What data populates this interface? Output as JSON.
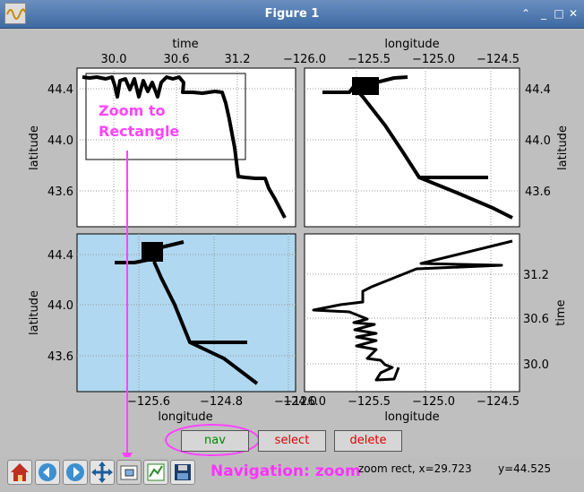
{
  "window": {
    "title": "Figure 1",
    "buttons": [
      "⌃",
      "_",
      "□",
      "✕"
    ]
  },
  "axes": {
    "top_left": {
      "xlabel_top": "time",
      "ylabel": "latitude",
      "xticks_top": [
        "30.0",
        "30.6",
        "31.2"
      ],
      "yticks": [
        "44.4",
        "44.0",
        "43.6"
      ]
    },
    "top_right": {
      "xlabel_top": "longitude",
      "ylabel_right": "latitude",
      "xticks_top": [
        "−126.0",
        "−125.5",
        "−125.0",
        "−124.5"
      ],
      "yticks": [
        "44.4",
        "44.0",
        "43.6"
      ]
    },
    "bottom_left": {
      "xlabel": "longitude",
      "ylabel": "latitude",
      "xticks": [
        "−125.6",
        "−124.8",
        "−124.0"
      ],
      "yticks": [
        "44.4",
        "44.0",
        "43.6"
      ]
    },
    "bottom_right": {
      "xlabel": "longitude",
      "ylabel_right": "time",
      "xticks": [
        "−126.0",
        "−125.5",
        "−125.0",
        "−124.5"
      ],
      "yticks": [
        "31.2",
        "30.6",
        "30.0"
      ]
    }
  },
  "annotation": {
    "zoom_line1": "Zoom to",
    "zoom_line2": "Rectangle"
  },
  "buttons": {
    "nav": "nav",
    "select": "select",
    "delete": "delete"
  },
  "navigation_label": "Navigation: zoom",
  "status": {
    "left": "zoom rect, x=29.723",
    "right": "y=44.525"
  },
  "colors": {
    "highlight": "#ff44ff",
    "axes_bg_selected": "#b0d8f0",
    "nav_text": "#008800",
    "select_text": "#e00000"
  },
  "icons": [
    "home-icon",
    "back-icon",
    "forward-icon",
    "pan-icon",
    "zoom-icon",
    "subplots-icon",
    "save-icon"
  ]
}
